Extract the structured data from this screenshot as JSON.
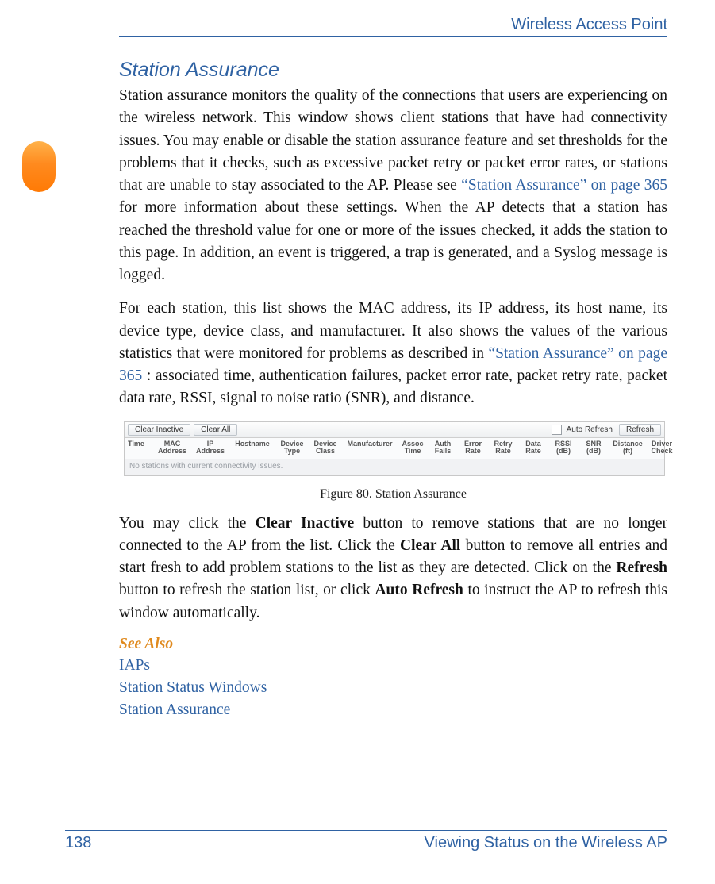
{
  "header": {
    "running_title": "Wireless Access Point"
  },
  "section": {
    "title": "Station Assurance"
  },
  "paragraphs": {
    "p1_a": "Station assurance monitors the quality of the connections that users are experiencing on the wireless network. This window shows client stations that have had connectivity issues. You may enable or disable the station assurance feature and set thresholds for the problems that it checks, such as excessive packet retry or packet error rates, or stations that are unable to stay associated to the AP. Please see ",
    "p1_xref1": "“Station Assurance” on page 365",
    "p1_b": " for more information about these settings. When the AP detects that a station has reached the threshold value for one or more of the issues checked, it adds the station to this page. In addition, an event is triggered, a trap is generated, and a Syslog message is logged.",
    "p2_a": "For each station, this list shows the MAC address, its IP address, its host name, its device type, device class, and manufacturer. It also shows the values of the various statistics that were monitored for problems as described in ",
    "p2_xref1": "“Station Assurance” on page 365",
    "p2_b": ": associated time, authentication failures, packet error rate, packet retry rate, packet data rate, RSSI, signal to noise ratio (SNR), and distance.",
    "p3_a": "You may click the ",
    "p3_b1": "Clear Inactive",
    "p3_c": " button to remove stations that are no longer connected to the AP from the list. Click the ",
    "p3_b2": "Clear All",
    "p3_d": " button to remove all entries and start fresh to add problem stations to the list as they are detected. Click on the ",
    "p3_b3": "Refresh",
    "p3_e": " button to refresh the station list, or click ",
    "p3_b4": "Auto Refresh",
    "p3_f": " to instruct the AP to refresh this window automatically."
  },
  "figure": {
    "caption": "Figure 80. Station Assurance",
    "toolbar": {
      "clear_inactive": "Clear Inactive",
      "clear_all": "Clear All",
      "auto_refresh": "Auto Refresh",
      "refresh": "Refresh"
    },
    "columns": {
      "time": "Time",
      "mac": "MAC Address",
      "ip": "IP Address",
      "host": "Hostname",
      "dtype": "Device Type",
      "dclass": "Device Class",
      "manu": "Manufacturer",
      "assoc": "Assoc Time",
      "auth": "Auth Fails",
      "err": "Error Rate",
      "retry": "Retry Rate",
      "data": "Data Rate",
      "rssi": "RSSI (dB)",
      "snr": "SNR (dB)",
      "dist": "Distance (ft)",
      "driver": "Driver Check"
    },
    "empty_msg": "No stations with current connectivity issues."
  },
  "see_also": {
    "heading": "See Also",
    "items": [
      "IAPs",
      "Station Status Windows",
      "Station Assurance"
    ]
  },
  "footer": {
    "page_no": "138",
    "chapter": "Viewing Status on the Wireless AP"
  }
}
